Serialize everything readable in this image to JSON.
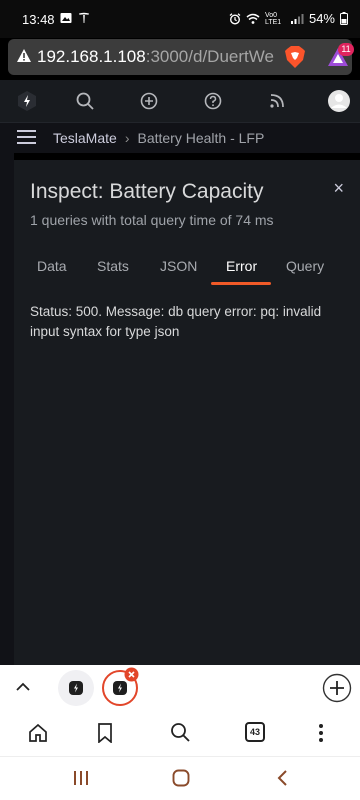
{
  "status_bar": {
    "time": "13:48",
    "network": "Vo0 LTE1",
    "battery": "54%"
  },
  "url_bar": {
    "host": "192.168.1.108",
    "path": ":3000/d/DuertWe",
    "rewards_count": "11"
  },
  "breadcrumb": {
    "root": "TeslaMate",
    "separator": "›",
    "current": "Battery Health - LFP"
  },
  "inspect": {
    "title": "Inspect: Battery Capacity",
    "subtitle": "1 queries with total query time of 74 ms",
    "close_symbol": "×",
    "tabs": [
      {
        "label": "Data"
      },
      {
        "label": "Stats"
      },
      {
        "label": "JSON"
      },
      {
        "label": "Error"
      },
      {
        "label": "Query"
      }
    ],
    "active_tab": "Error",
    "error_message": "Status: 500. Message: db query error: pq: invalid input syntax for type json"
  },
  "browser_toolbar": {
    "tab_count": "43"
  },
  "colors": {
    "accent": "#f05a28",
    "panel": "#181b1f",
    "background": "#111217"
  }
}
